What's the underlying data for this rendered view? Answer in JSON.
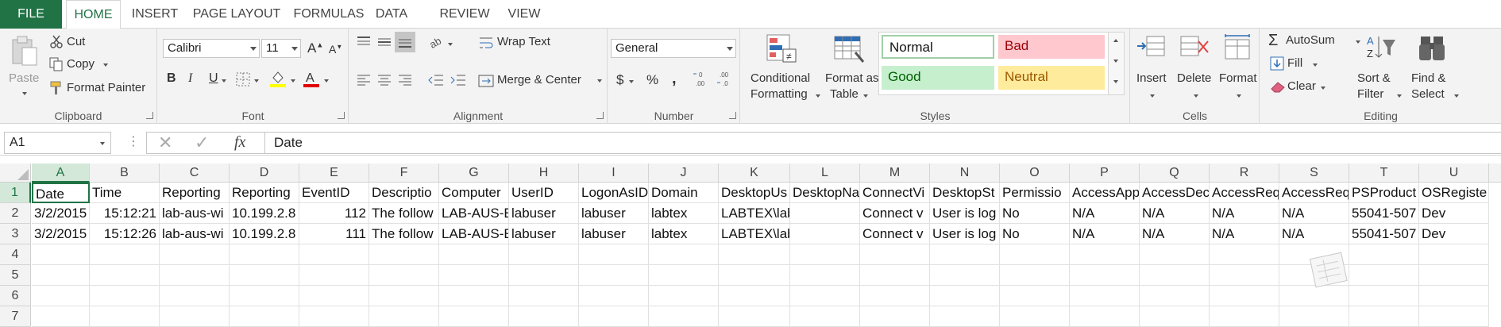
{
  "tabs": [
    "FILE",
    "HOME",
    "INSERT",
    "PAGE LAYOUT",
    "FORMULAS",
    "DATA",
    "REVIEW",
    "VIEW"
  ],
  "active_tab": "HOME",
  "clipboard": {
    "paste": "Paste",
    "cut": "Cut",
    "copy": "Copy",
    "format_painter": "Format Painter",
    "group_label": "Clipboard"
  },
  "font": {
    "name": "Calibri",
    "size": "11",
    "bold": "B",
    "italic": "I",
    "underline": "U",
    "group_label": "Font"
  },
  "alignment": {
    "wrap_text": "Wrap Text",
    "merge_center": "Merge & Center",
    "group_label": "Alignment"
  },
  "number": {
    "format": "General",
    "currency": "$",
    "percent": "%",
    "comma": ",",
    "group_label": "Number"
  },
  "styles": {
    "conditional_1": "Conditional",
    "conditional_2": "Formatting",
    "format_table_1": "Format as",
    "format_table_2": "Table",
    "normal": "Normal",
    "bad": "Bad",
    "good": "Good",
    "neutral": "Neutral",
    "group_label": "Styles"
  },
  "cells_group": {
    "insert": "Insert",
    "delete": "Delete",
    "format": "Format",
    "group_label": "Cells"
  },
  "editing": {
    "autosum": "AutoSum",
    "fill": "Fill",
    "clear": "Clear",
    "sort_1": "Sort &",
    "sort_2": "Filter",
    "find_1": "Find &",
    "find_2": "Select",
    "group_label": "Editing"
  },
  "formula_bar": {
    "name_box": "A1",
    "fx": "fx",
    "content": "Date"
  },
  "colors": {
    "accent": "#217346",
    "bad_bg": "#ffc7ce",
    "bad_fg": "#9c0006",
    "good_bg": "#c6efce",
    "good_fg": "#006100",
    "neutral_bg": "#ffeb9c",
    "neutral_fg": "#9c5700"
  },
  "columns": [
    "A",
    "B",
    "C",
    "D",
    "E",
    "F",
    "G",
    "H",
    "I",
    "J",
    "K",
    "L",
    "M",
    "N",
    "O",
    "P",
    "Q",
    "R",
    "S",
    "T",
    "U"
  ],
  "rows": [
    "1",
    "2",
    "3",
    "4",
    "5",
    "6",
    "7"
  ],
  "sheet": [
    [
      "Date",
      "Time",
      "Reporting",
      "Reporting",
      "EventID",
      "Descriptio",
      "Computer",
      "UserID",
      "LogonAsID",
      "Domain",
      "DesktopUs",
      "DesktopNa",
      "ConnectVi",
      "DesktopSt",
      "Permissio",
      "AccessApp",
      "AccessDec",
      "AccessReq",
      "AccessReq",
      "PSProduct",
      "OSRegiste"
    ],
    [
      "3/2/2015",
      "15:12:21",
      "lab-aus-wi",
      "10.199.2.8",
      "112",
      "The follow",
      "LAB-AUS-E",
      "labuser",
      "labuser",
      "labtex",
      "LABTEX\\labuser",
      "",
      "Connect v",
      "User is log",
      "No",
      "N/A",
      "N/A",
      "N/A",
      "N/A",
      "55041-507",
      "Dev"
    ],
    [
      "3/2/2015",
      "15:12:26",
      "lab-aus-wi",
      "10.199.2.8",
      "111",
      "The follow",
      "LAB-AUS-E",
      "labuser",
      "labuser",
      "labtex",
      "LABTEX\\labuser",
      "",
      "Connect v",
      "User is log",
      "No",
      "N/A",
      "N/A",
      "N/A",
      "N/A",
      "55041-507",
      "Dev"
    ]
  ]
}
